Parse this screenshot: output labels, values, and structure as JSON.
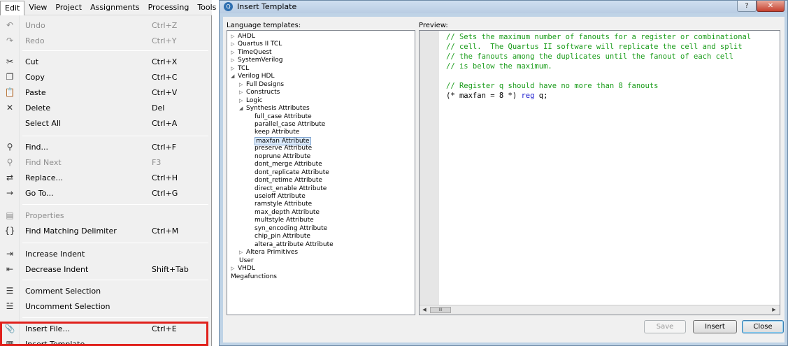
{
  "menubar": {
    "items": [
      "Edit",
      "View",
      "Project",
      "Assignments",
      "Processing",
      "Tools"
    ]
  },
  "edit_menu": {
    "items": [
      {
        "label": "Undo",
        "shortcut": "Ctrl+Z",
        "icon": "undo-icon",
        "glyph": "↶",
        "disabled": true
      },
      {
        "label": "Redo",
        "shortcut": "Ctrl+Y",
        "icon": "redo-icon",
        "glyph": "↷",
        "disabled": true
      },
      {
        "label": "Cut",
        "shortcut": "Ctrl+X",
        "icon": "cut-icon",
        "glyph": "✂",
        "disabled": false
      },
      {
        "label": "Copy",
        "shortcut": "Ctrl+C",
        "icon": "copy-icon",
        "glyph": "❐",
        "disabled": false
      },
      {
        "label": "Paste",
        "shortcut": "Ctrl+V",
        "icon": "paste-icon",
        "glyph": "📋",
        "disabled": false
      },
      {
        "label": "Delete",
        "shortcut": "Del",
        "icon": "delete-icon",
        "glyph": "✕",
        "disabled": false
      },
      {
        "label": "Select All",
        "shortcut": "Ctrl+A",
        "icon": "",
        "glyph": "",
        "disabled": false
      },
      {
        "label": "Find...",
        "shortcut": "Ctrl+F",
        "icon": "find-icon",
        "glyph": "⚲",
        "disabled": false
      },
      {
        "label": "Find Next",
        "shortcut": "F3",
        "icon": "find-next-icon",
        "glyph": "⚲",
        "disabled": true
      },
      {
        "label": "Replace...",
        "shortcut": "Ctrl+H",
        "icon": "replace-icon",
        "glyph": "⇄",
        "disabled": false
      },
      {
        "label": "Go To...",
        "shortcut": "Ctrl+G",
        "icon": "goto-arrow-icon",
        "glyph": "→",
        "disabled": false
      },
      {
        "label": "Properties",
        "shortcut": "",
        "icon": "properties-icon",
        "glyph": "▤",
        "disabled": true
      },
      {
        "label": "Find Matching Delimiter",
        "shortcut": "Ctrl+M",
        "icon": "braces-icon",
        "glyph": "{}",
        "disabled": false
      },
      {
        "label": "Increase Indent",
        "shortcut": "",
        "icon": "increase-indent-icon",
        "glyph": "⇥",
        "disabled": false
      },
      {
        "label": "Decrease Indent",
        "shortcut": "Shift+Tab",
        "icon": "decrease-indent-icon",
        "glyph": "⇤",
        "disabled": false
      },
      {
        "label": "Comment Selection",
        "shortcut": "",
        "icon": "comment-icon",
        "glyph": "☰",
        "disabled": false
      },
      {
        "label": "Uncomment Selection",
        "shortcut": "",
        "icon": "uncomment-icon",
        "glyph": "☱",
        "disabled": false
      },
      {
        "label": "Insert File...",
        "shortcut": "Ctrl+E",
        "icon": "paperclip-icon",
        "glyph": "📎",
        "disabled": false
      },
      {
        "label": "Insert Template...",
        "shortcut": "",
        "icon": "template-icon",
        "glyph": "▦",
        "disabled": false
      }
    ]
  },
  "dialog": {
    "title": "Insert Template",
    "help": "?",
    "close": "✕",
    "language_templates_label": "Language templates:",
    "preview_label": "Preview:",
    "tree": [
      {
        "label": "AHDL",
        "level": 0,
        "tri": "▷"
      },
      {
        "label": "Quartus II TCL",
        "level": 0,
        "tri": "▷"
      },
      {
        "label": "TimeQuest",
        "level": 0,
        "tri": "▷"
      },
      {
        "label": "SystemVerilog",
        "level": 0,
        "tri": "▷"
      },
      {
        "label": "TCL",
        "level": 0,
        "tri": "▷"
      },
      {
        "label": "Verilog HDL",
        "level": 0,
        "tri": "◢"
      },
      {
        "label": "Full Designs",
        "level": 1,
        "tri": "▷"
      },
      {
        "label": "Constructs",
        "level": 1,
        "tri": "▷"
      },
      {
        "label": "Logic",
        "level": 1,
        "tri": "▷"
      },
      {
        "label": "Synthesis Attributes",
        "level": 1,
        "tri": "◢"
      },
      {
        "label": "full_case Attribute",
        "level": 2,
        "tri": ""
      },
      {
        "label": "parallel_case Attribute",
        "level": 2,
        "tri": ""
      },
      {
        "label": "keep Attribute",
        "level": 2,
        "tri": ""
      },
      {
        "label": "maxfan Attribute",
        "level": 2,
        "tri": "",
        "selected": true
      },
      {
        "label": "preserve Attribute",
        "level": 2,
        "tri": ""
      },
      {
        "label": "noprune Attribute",
        "level": 2,
        "tri": ""
      },
      {
        "label": "dont_merge Attribute",
        "level": 2,
        "tri": ""
      },
      {
        "label": "dont_replicate Attribute",
        "level": 2,
        "tri": ""
      },
      {
        "label": "dont_retime Attribute",
        "level": 2,
        "tri": ""
      },
      {
        "label": "direct_enable Attribute",
        "level": 2,
        "tri": ""
      },
      {
        "label": "useioff Attribute",
        "level": 2,
        "tri": ""
      },
      {
        "label": "ramstyle Attribute",
        "level": 2,
        "tri": ""
      },
      {
        "label": "max_depth Attribute",
        "level": 2,
        "tri": ""
      },
      {
        "label": "multstyle Attribute",
        "level": 2,
        "tri": ""
      },
      {
        "label": "syn_encoding Attribute",
        "level": 2,
        "tri": ""
      },
      {
        "label": "chip_pin Attribute",
        "level": 2,
        "tri": ""
      },
      {
        "label": "altera_attribute Attribute",
        "level": 2,
        "tri": ""
      },
      {
        "label": "Altera Primitives",
        "level": 1,
        "tri": "▷"
      },
      {
        "label": "User",
        "level": 1,
        "tri": ""
      },
      {
        "label": "VHDL",
        "level": 0,
        "tri": "▷"
      },
      {
        "label": "Megafunctions",
        "level": 0,
        "tri": ""
      }
    ],
    "preview_code": [
      [
        {
          "t": "// Sets the maximum number of fanouts for a register or combinational",
          "c": "cm"
        }
      ],
      [
        {
          "t": "// cell.  The Quartus II software will replicate the cell and split",
          "c": "cm"
        }
      ],
      [
        {
          "t": "// the fanouts among the duplicates until the fanout of each cell",
          "c": "cm"
        }
      ],
      [
        {
          "t": "// is below the maximum.",
          "c": "cm"
        }
      ],
      [],
      [
        {
          "t": "// Register q should have no more than 8 fanouts",
          "c": "cm"
        }
      ],
      [
        {
          "t": "(* maxfan = 8 *) ",
          "c": ""
        },
        {
          "t": "reg",
          "c": "kw"
        },
        {
          "t": " q;",
          "c": ""
        }
      ]
    ],
    "scroll_thumb": "III",
    "buttons": {
      "save": "Save",
      "insert": "Insert",
      "close": "Close"
    }
  }
}
